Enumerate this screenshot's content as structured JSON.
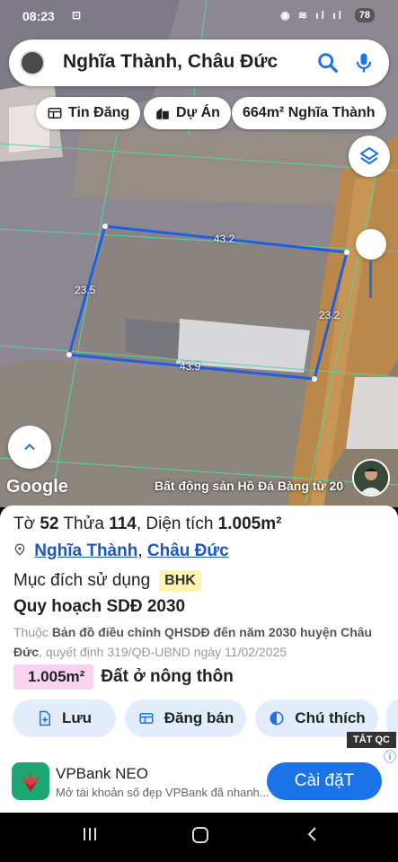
{
  "status_bar": {
    "time": "08:23",
    "battery": "78"
  },
  "search": {
    "query": "Nghĩa Thành, Châu Đức"
  },
  "chips": [
    {
      "label": "Tin Đăng",
      "icon": "newspaper-icon"
    },
    {
      "label": "Dự Án",
      "icon": "building-icon"
    },
    {
      "label": "664m² Nghĩa Thành"
    }
  ],
  "map": {
    "edges": {
      "top": "43.2",
      "left": "23.5",
      "right": "23.2",
      "bottom": "43.9"
    },
    "logo": "Google",
    "attribution": "Bất động sản Hồ Đá Bàng từ 20"
  },
  "parcel": {
    "to_label": "Tờ",
    "to_value": "52",
    "thua_label": "Thửa",
    "thua_value": "114",
    "area_label": "Diện tích",
    "area_value": "1.005m²",
    "commune": "Nghĩa Thành",
    "separator": ",",
    "district": "Châu Đức",
    "purpose_label": "Mục đích sử dụng",
    "purpose_code": "BHK",
    "plan_title": "Quy hoạch SDĐ 2030",
    "plan_prefix": "Thuộc",
    "plan_name": "Bản đồ điều chỉnh QHSDĐ đến năm 2030 huyện Châu Đức",
    "plan_decision": ", quyết định 319/QĐ-UBND ngày 11/02/2025",
    "zone_area": "1.005m²",
    "zone_type": "Đất ở nông thôn"
  },
  "actions": [
    {
      "label": "Lưu"
    },
    {
      "label": "Đăng bán"
    },
    {
      "label": "Chú thích"
    }
  ],
  "ad": {
    "close_label": "TẮT QC",
    "title": "VPBank NEO",
    "description": "Mở tài khoản số đẹp VPBank đã nhanh...",
    "cta": "Cài đặT"
  },
  "colors": {
    "accent": "#1a73e8",
    "parcel_outline": "#1f5fe0",
    "action_bg": "#e3ecfb"
  }
}
